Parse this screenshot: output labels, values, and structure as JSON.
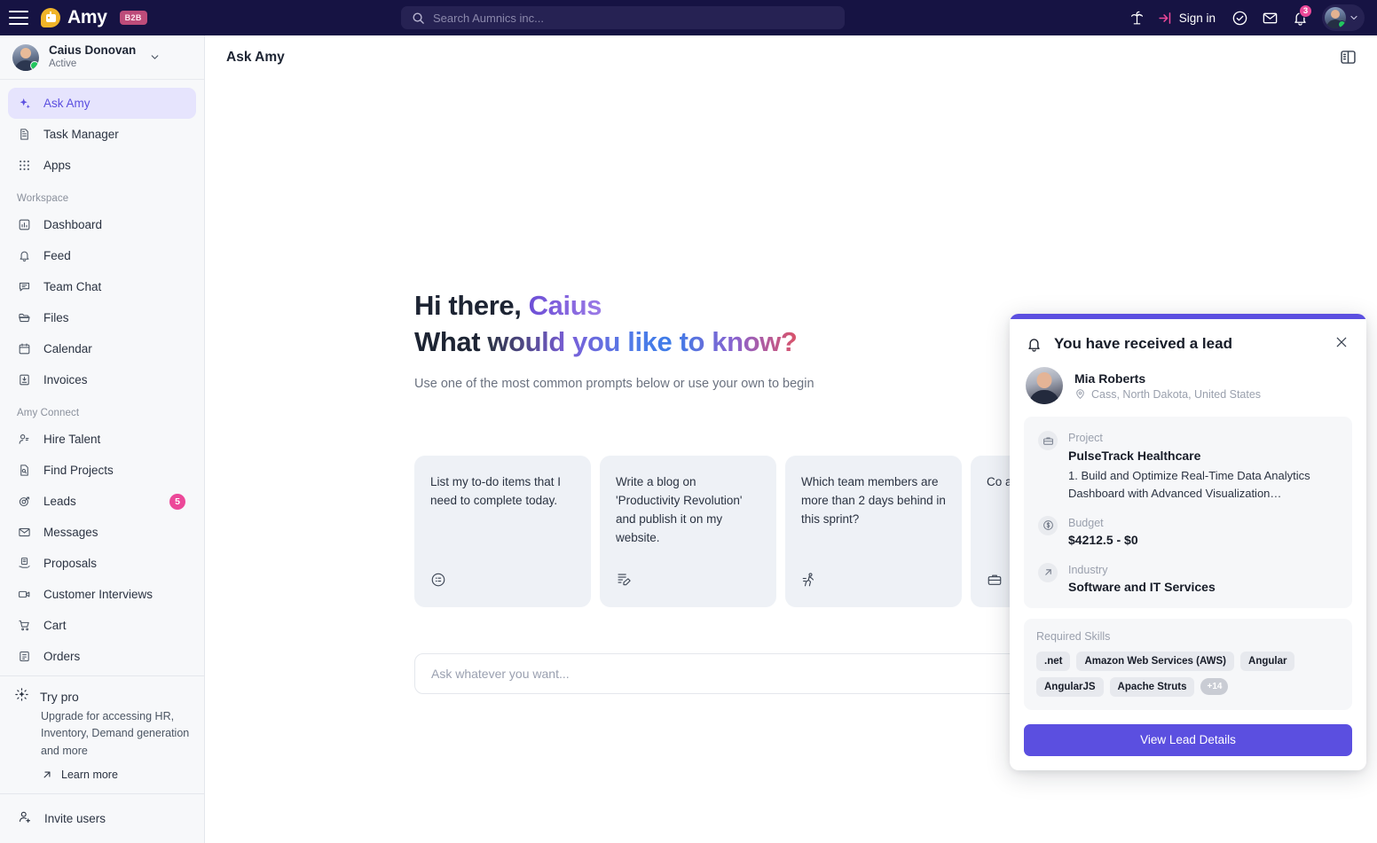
{
  "topbar": {
    "menu_icon": "hamburger-icon",
    "brand_name": "Amy",
    "brand_badge": "B2B",
    "search": {
      "placeholder": "Search Aumnics inc...",
      "value": "",
      "icon": "search-icon"
    },
    "vacation_icon": "palm-tree-icon",
    "signin_label": "Sign in",
    "signin_icon": "login-arrow-icon",
    "tasks_icon": "check-circle-icon",
    "mail_icon": "envelope-icon",
    "bell_icon": "bell-icon",
    "bell_count": "3",
    "avatar_icon": "user-avatar",
    "avatar_chevron_icon": "chevron-down-icon"
  },
  "sidebar": {
    "profile": {
      "name": "Caius Donovan",
      "status": "Active",
      "chevron_icon": "chevron-down-icon",
      "avatar_icon": "user-avatar"
    },
    "primary": [
      {
        "label": "Ask Amy",
        "icon": "sparkle-icon",
        "active": true
      },
      {
        "label": "Task Manager",
        "icon": "document-icon",
        "active": false
      },
      {
        "label": "Apps",
        "icon": "grid-dots-icon",
        "active": false
      }
    ],
    "section_workspace": "Workspace",
    "workspace": [
      {
        "label": "Dashboard",
        "icon": "chart-bar-icon"
      },
      {
        "label": "Feed",
        "icon": "bell-icon"
      },
      {
        "label": "Team Chat",
        "icon": "chat-bubble-icon"
      },
      {
        "label": "Files",
        "icon": "folder-icon"
      },
      {
        "label": "Calendar",
        "icon": "calendar-icon"
      },
      {
        "label": "Invoices",
        "icon": "invoice-icon"
      }
    ],
    "section_connect": "Amy Connect",
    "connect": [
      {
        "label": "Hire Talent",
        "icon": "person-search-icon",
        "badge": ""
      },
      {
        "label": "Find Projects",
        "icon": "document-search-icon",
        "badge": ""
      },
      {
        "label": "Leads",
        "icon": "target-icon",
        "badge": "5"
      },
      {
        "label": "Messages",
        "icon": "envelope-icon",
        "badge": ""
      },
      {
        "label": "Proposals",
        "icon": "proposal-hand-icon",
        "badge": ""
      },
      {
        "label": "Customer Interviews",
        "icon": "video-camera-icon",
        "badge": ""
      },
      {
        "label": "Cart",
        "icon": "shopping-cart-icon",
        "badge": ""
      },
      {
        "label": "Orders",
        "icon": "order-box-icon",
        "badge": ""
      }
    ],
    "trypro": {
      "title": "Try pro",
      "icon": "sun-sparkle-icon",
      "description": "Upgrade for accessing HR, Inventory, Demand generation and more",
      "link_label": "Learn more",
      "link_icon": "arrow-up-right-icon"
    },
    "invite": {
      "label": "Invite users",
      "icon": "add-user-icon"
    }
  },
  "main": {
    "title": "Ask Amy",
    "panel_toggle_icon": "layout-panel-icon",
    "hero": {
      "line1_static": "Hi there, ",
      "line1_accent": "Caius",
      "line2_static": "What ",
      "line2_accent": "would you like to know?",
      "subtitle": "Use one of the most common prompts below or use your own to begin"
    },
    "prompt_cards": [
      {
        "text": "List my to-do items that I need to complete today.",
        "icon": "checklist-face-icon",
        "glyph": "⊜"
      },
      {
        "text": "Write a blog on 'Productivity Revolution' and publish it on my website.",
        "icon": "document-edit-icon",
        "glyph": "✎"
      },
      {
        "text": "Which team members are more than 2 days behind in this sprint?",
        "icon": "running-person-icon",
        "glyph": "⚔"
      },
      {
        "text": "Co app app for",
        "icon": "briefcase-icon",
        "glyph": "⛏"
      }
    ],
    "ask_input": {
      "placeholder": "Ask whatever you want...",
      "value": ""
    }
  },
  "lead_card": {
    "accent_color": "#5b4fe0",
    "bell_icon": "bell-icon",
    "title": "You have received a lead",
    "close_icon": "close-icon",
    "person": {
      "name": "Mia Roberts",
      "location": "Cass, North Dakota, United States",
      "location_icon": "map-pin-icon",
      "avatar_icon": "user-avatar"
    },
    "details": [
      {
        "key": "Project",
        "value": "PulseTrack Healthcare",
        "desc": "1. Build and Optimize Real-Time Data Analytics Dashboard with Advanced Visualization…",
        "icon": "briefcase-icon"
      },
      {
        "key": "Budget",
        "value": "$4212.5 - $0",
        "desc": "",
        "icon": "dollar-circle-icon"
      },
      {
        "key": "Industry",
        "value": "Software and IT Services",
        "desc": "",
        "icon": "arrow-up-right-icon"
      }
    ],
    "skills_label": "Required Skills",
    "skills": [
      ".net",
      "Amazon Web Services (AWS)",
      "Angular",
      "AngularJS",
      "Apache Struts"
    ],
    "skills_more": "+14",
    "cta_label": "View Lead Details"
  }
}
